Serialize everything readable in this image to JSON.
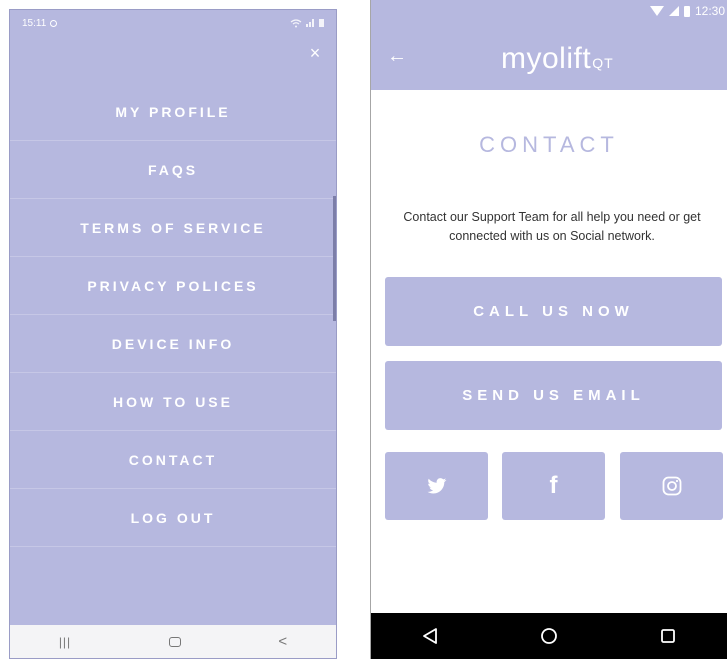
{
  "left_phone": {
    "status_time": "15:11",
    "close_symbol": "×",
    "menu_items": [
      {
        "label": "MY PROFILE"
      },
      {
        "label": "FAQS"
      },
      {
        "label": "TERMS OF SERVICE"
      },
      {
        "label": "PRIVACY POLICES"
      },
      {
        "label": "DEVICE INFO"
      },
      {
        "label": "HOW TO USE"
      },
      {
        "label": "CONTACT"
      },
      {
        "label": "LOG OUT"
      }
    ],
    "nav": {
      "recent": "|||",
      "back": "<"
    }
  },
  "right_phone": {
    "status_time": "12:30",
    "back_symbol": "←",
    "logo": {
      "main": "myolift",
      "suffix": "QT"
    },
    "title": "CONTACT",
    "description": "Contact our Support Team for all help you need or get connected with us on Social network.",
    "call_button": "CALL US NOW",
    "email_button": "SEND US EMAIL",
    "social": [
      "twitter",
      "facebook",
      "instagram"
    ],
    "facebook_glyph": "f"
  },
  "colors": {
    "accent": "#b6b8df",
    "white": "#ffffff",
    "text": "#333333",
    "nav_dark": "#000000"
  }
}
